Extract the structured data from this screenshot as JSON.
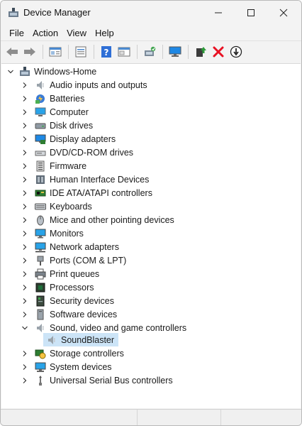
{
  "window": {
    "title": "Device Manager"
  },
  "window_controls": {
    "minimize": "minimize-icon",
    "maximize": "maximize-icon",
    "close": "close-icon"
  },
  "menu": [
    "File",
    "Action",
    "View",
    "Help"
  ],
  "toolbar": [
    "back-arrow-icon",
    "forward-arrow-icon",
    "properties-view-icon",
    "device-list-icon",
    "help-icon",
    "console-view-icon",
    "scan-hardware-icon",
    "monitor-icon",
    "update-driver-icon",
    "uninstall-icon",
    "disable-device-icon"
  ],
  "tree": {
    "root": {
      "label": "Windows-Home",
      "icon": "computer-root-icon",
      "expanded": true
    },
    "categories": [
      {
        "label": "Audio inputs and outputs",
        "icon": "speaker-icon"
      },
      {
        "label": "Batteries",
        "icon": "battery-icon"
      },
      {
        "label": "Computer",
        "icon": "computer-icon"
      },
      {
        "label": "Disk drives",
        "icon": "disk-drive-icon"
      },
      {
        "label": "Display adapters",
        "icon": "display-adapter-icon"
      },
      {
        "label": "DVD/CD-ROM drives",
        "icon": "optical-drive-icon"
      },
      {
        "label": "Firmware",
        "icon": "firmware-icon"
      },
      {
        "label": "Human Interface Devices",
        "icon": "hid-icon"
      },
      {
        "label": "IDE ATA/ATAPI controllers",
        "icon": "ide-controller-icon"
      },
      {
        "label": "Keyboards",
        "icon": "keyboard-icon"
      },
      {
        "label": "Mice and other pointing devices",
        "icon": "mouse-icon"
      },
      {
        "label": "Monitors",
        "icon": "monitor-icon"
      },
      {
        "label": "Network adapters",
        "icon": "network-adapter-icon"
      },
      {
        "label": "Ports (COM & LPT)",
        "icon": "port-icon"
      },
      {
        "label": "Print queues",
        "icon": "printer-icon"
      },
      {
        "label": "Processors",
        "icon": "processor-icon"
      },
      {
        "label": "Security devices",
        "icon": "security-device-icon"
      },
      {
        "label": "Software devices",
        "icon": "software-device-icon"
      },
      {
        "label": "Sound, video and game controllers",
        "icon": "speaker-icon",
        "expanded": true,
        "children": [
          {
            "label": "SoundBlaster",
            "icon": "speaker-icon",
            "selected": true
          }
        ]
      },
      {
        "label": "Storage controllers",
        "icon": "storage-controller-icon"
      },
      {
        "label": "System devices",
        "icon": "system-device-icon"
      },
      {
        "label": "Universal Serial Bus controllers",
        "icon": "usb-icon"
      }
    ]
  },
  "colors": {
    "selection": "#cce4f7",
    "accent": "#0078d4",
    "uninstall_red": "#e81123"
  }
}
